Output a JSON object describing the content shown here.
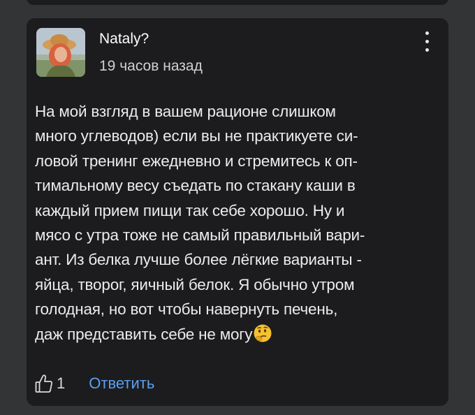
{
  "comment": {
    "author": "Nataly?",
    "time": "19 часов назад",
    "avatar_icon": "user-photo-avatar",
    "menu_icon": "more-vertical-icon",
    "body_lines": [
      "На мой взгляд в вашем рационе слишком",
      "много углеводов) если вы не практикуете си-",
      "ловой тренинг ежедневно и стремитесь к оп-",
      "тимальному весу съедать по стакану каши в",
      "каждый прием пищи так себе хорошо. Ну и",
      "мясо с утра тоже не самый правильный вари-",
      "ант. Из белка лучше более лёгкие варианты -",
      "яйца, творог, яичный белок. Я обычно утром",
      "голодная, но вот чтобы навернуть печень,",
      "даж представить себе не могу"
    ],
    "trailing_emoji": "thinking-face-emoji",
    "likes": "1",
    "like_icon": "thumbs-up-outline-icon",
    "reply_label": "Ответить"
  },
  "colors": {
    "page_bg": "#333436",
    "card_bg": "#1c1c1e",
    "text": "#ececec",
    "link": "#5aa0ef"
  }
}
